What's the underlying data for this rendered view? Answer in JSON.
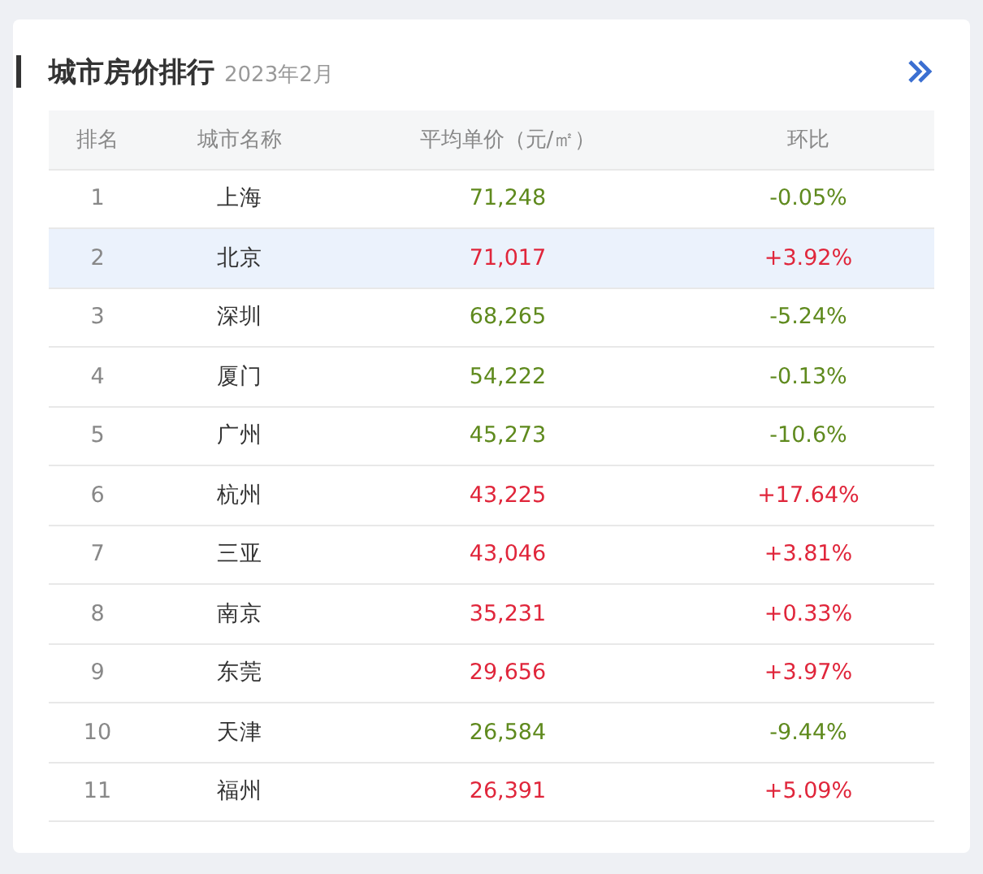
{
  "title": "城市房价排行",
  "subtitle": "2023年2月",
  "table": {
    "columns": [
      "排名",
      "城市名称",
      "平均单价（元/㎡）",
      "环比"
    ],
    "rows": [
      {
        "rank": "1",
        "city": "上海",
        "price": "71,248",
        "change": "-0.05%",
        "color": "#5f8a1e",
        "selected": false
      },
      {
        "rank": "2",
        "city": "北京",
        "price": "71,017",
        "change": "+3.92%",
        "color": "#e0263b",
        "selected": true
      },
      {
        "rank": "3",
        "city": "深圳",
        "price": "68,265",
        "change": "-5.24%",
        "color": "#5f8a1e",
        "selected": false
      },
      {
        "rank": "4",
        "city": "厦门",
        "price": "54,222",
        "change": "-0.13%",
        "color": "#5f8a1e",
        "selected": false
      },
      {
        "rank": "5",
        "city": "广州",
        "price": "45,273",
        "change": "-10.6%",
        "color": "#5f8a1e",
        "selected": false
      },
      {
        "rank": "6",
        "city": "杭州",
        "price": "43,225",
        "change": "+17.64%",
        "color": "#e0263b",
        "selected": false
      },
      {
        "rank": "7",
        "city": "三亚",
        "price": "43,046",
        "change": "+3.81%",
        "color": "#e0263b",
        "selected": false
      },
      {
        "rank": "8",
        "city": "南京",
        "price": "35,231",
        "change": "+0.33%",
        "color": "#e0263b",
        "selected": false
      },
      {
        "rank": "9",
        "city": "东莞",
        "price": "29,656",
        "change": "+3.97%",
        "color": "#e0263b",
        "selected": false
      },
      {
        "rank": "10",
        "city": "天津",
        "price": "26,584",
        "change": "-9.44%",
        "color": "#5f8a1e",
        "selected": false
      },
      {
        "rank": "11",
        "city": "福州",
        "price": "26,391",
        "change": "+5.09%",
        "color": "#e0263b",
        "selected": false
      }
    ]
  }
}
